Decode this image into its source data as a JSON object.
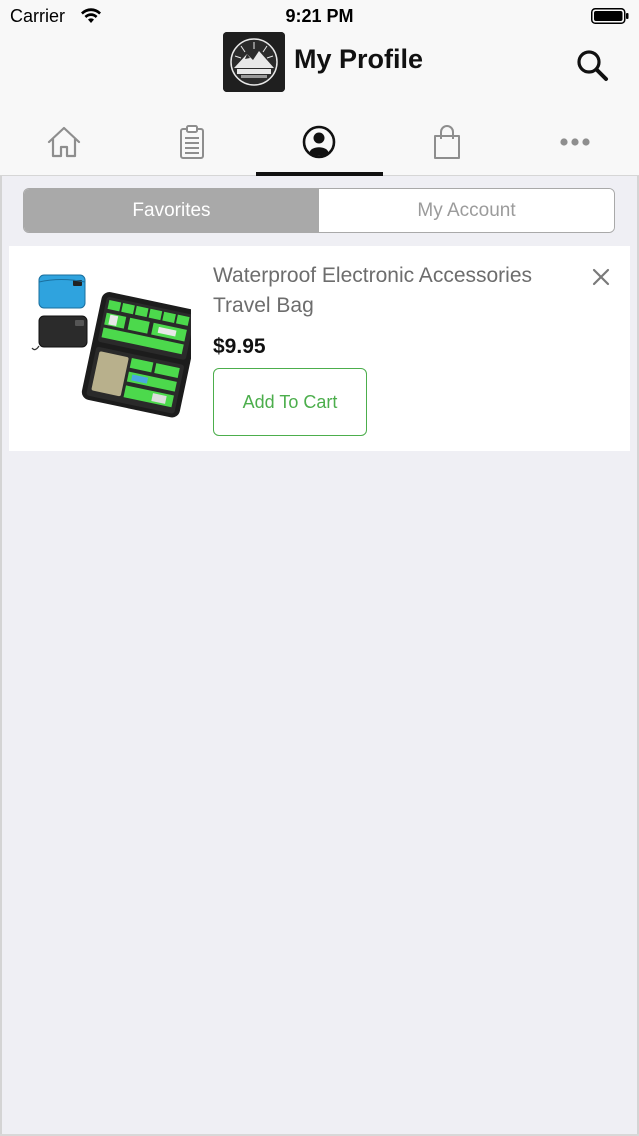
{
  "status_bar": {
    "carrier": "Carrier",
    "time": "9:21 PM"
  },
  "header": {
    "title": "My Profile",
    "logo_icon": "mountain-sun-logo",
    "search_icon": "search-icon"
  },
  "tabs": [
    {
      "name": "home",
      "icon": "home-icon"
    },
    {
      "name": "orders",
      "icon": "clipboard-icon"
    },
    {
      "name": "profile",
      "icon": "user-circle-icon",
      "active": true
    },
    {
      "name": "shop",
      "icon": "shopping-bag-icon"
    },
    {
      "name": "more",
      "icon": "more-dots-icon"
    }
  ],
  "segments": {
    "favorites": "Favorites",
    "my_account": "My Account",
    "selected": "favorites"
  },
  "favorites": [
    {
      "title": "Waterproof Electronic Accessories Travel Bag",
      "price": "$9.95",
      "button_label": "Add To Cart"
    }
  ],
  "colors": {
    "accent_green": "#4cae4c",
    "segment_active": "#a9a9a9",
    "background": "#efeff4"
  }
}
